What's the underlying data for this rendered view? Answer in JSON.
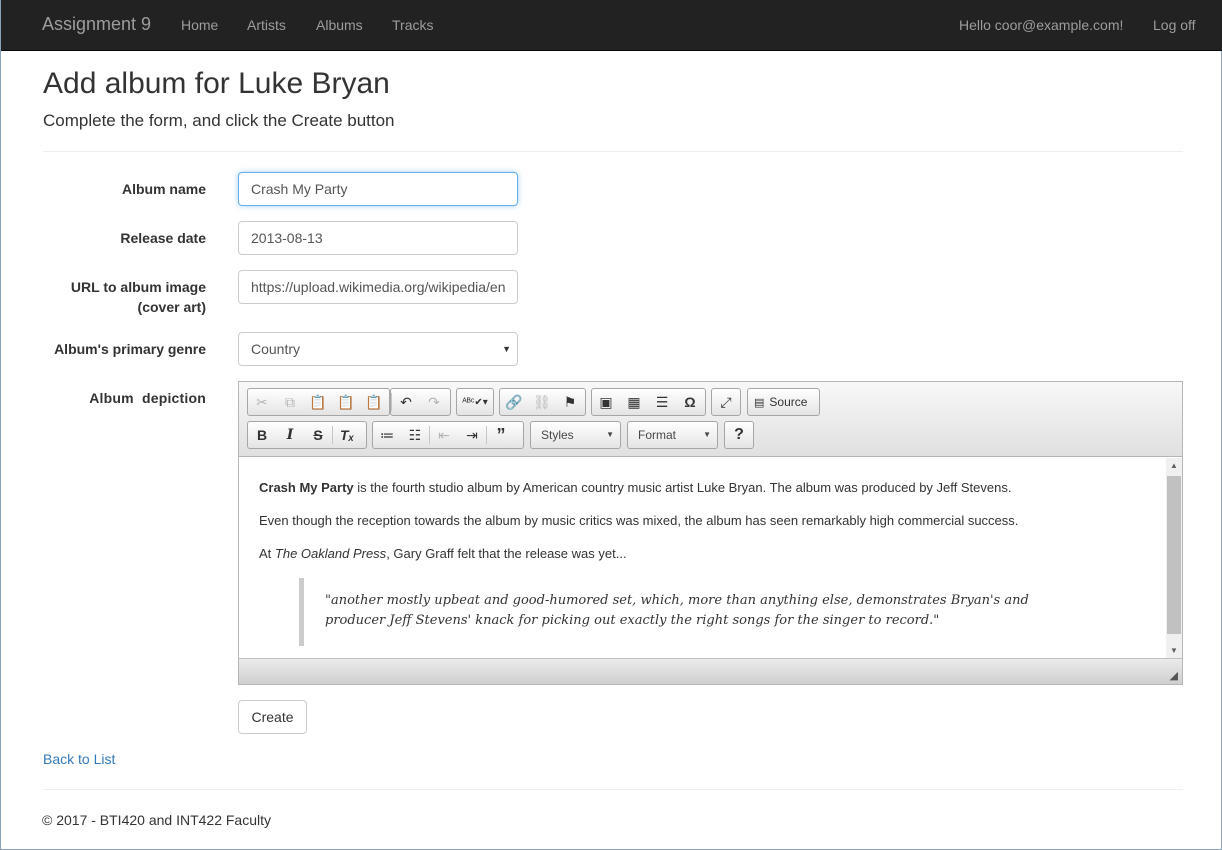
{
  "navbar": {
    "brand": "Assignment 9",
    "links": [
      "Home",
      "Artists",
      "Albums",
      "Tracks"
    ],
    "greeting": "Hello coor@example.com!",
    "logoff": "Log off"
  },
  "header": {
    "title": "Add album for Luke Bryan",
    "subtitle": "Complete the form, and click the Create button"
  },
  "form": {
    "album_name_label": "Album name",
    "album_name_value": "Crash My Party",
    "release_date_label": "Release date",
    "release_date_value": "2013-08-13",
    "url_label_line1": "URL to album image",
    "url_label_line2": "(cover art)",
    "url_value": "https://upload.wikimedia.org/wikipedia/en",
    "genre_label": "Album's primary genre",
    "genre_value": "Country",
    "depiction_label": "Album  depiction",
    "create_button": "Create"
  },
  "editor": {
    "source_label": "Source",
    "styles_label": "Styles",
    "format_label": "Format",
    "help_label": "?",
    "toolbar_icons": {
      "row1": [
        "cut-icon",
        "copy-icon",
        "paste-icon",
        "paste-text-icon",
        "paste-word-icon",
        "undo-icon",
        "redo-icon",
        "spellcheck-icon",
        "link-icon",
        "unlink-icon",
        "anchor-icon",
        "image-icon",
        "table-icon",
        "horizontal-line-icon",
        "special-char-icon",
        "maximize-icon",
        "source-icon"
      ],
      "row2": [
        "bold-icon",
        "italic-icon",
        "strikethrough-icon",
        "remove-format-icon",
        "numbered-list-icon",
        "bulleted-list-icon",
        "outdent-icon",
        "indent-icon",
        "blockquote-icon",
        "help-icon"
      ]
    },
    "content": {
      "p1_bold": "Crash My Party",
      "p1_rest": " is the fourth studio album by American country music artist Luke Bryan. The album was produced by Jeff Stevens.",
      "p2": "Even though the reception towards the album by music critics was mixed, the album has seen remarkably high commercial success.",
      "p3_prefix": "At ",
      "p3_italic": "The Oakland Press",
      "p3_rest": ", Gary Graff felt that the release was yet...",
      "quote": "\"another mostly upbeat and good-humored set, which, more than anything else, demonstrates Bryan's and producer Jeff Stevens' knack for picking out exactly the right songs for the singer to record.\""
    }
  },
  "back_link": "Back to List",
  "footer": "© 2017 - BTI420 and INT422 Faculty"
}
